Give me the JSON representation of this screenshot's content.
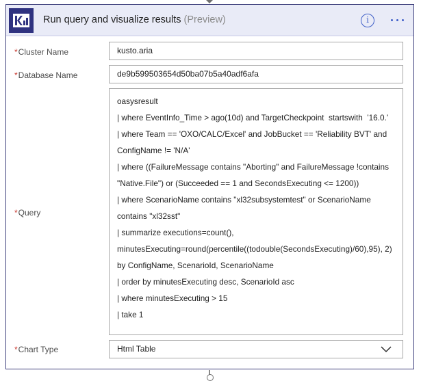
{
  "card": {
    "title": "Run query and visualize results",
    "preview_tag": "(Preview)",
    "logo_icon": "kusto-logo-icon",
    "info_icon": "info-icon",
    "more_icon": "more-options-icon",
    "accent_color": "#3b3d7a"
  },
  "fields": {
    "cluster": {
      "required_mark": "*",
      "label": "Cluster Name",
      "value": "kusto.aria"
    },
    "database": {
      "required_mark": "*",
      "label": "Database Name",
      "value": "de9b599503654d50ba07b5a40adf6afa"
    },
    "query": {
      "required_mark": "*",
      "label": "Query",
      "lines": [
        "oasysresult",
        "| where EventInfo_Time > ago(10d) and TargetCheckpoint  startswith  '16.0.'",
        "| where Team == 'OXO/CALC/Excel' and JobBucket == 'Reliability BVT' and",
        "ConfigName != 'N/A'",
        "| where ((FailureMessage contains \"Aborting\" and FailureMessage !contains",
        "\"Native.File\") or (Succeeded == 1 and SecondsExecuting <= 1200))",
        "| where ScenarioName contains \"xl32subsystemtest\" or ScenarioName",
        "contains \"xl32sst\"",
        "| summarize executions=count(),",
        "minutesExecuting=round(percentile((todouble(SecondsExecuting)/60),95), 2)",
        "by ConfigName, ScenarioId, ScenarioName",
        "| order by minutesExecuting desc, ScenarioId asc",
        "| where minutesExecuting > 15",
        "| take 1"
      ]
    },
    "chart_type": {
      "required_mark": "*",
      "label": "Chart Type",
      "value": "Html Table",
      "chevron_icon": "chevron-down-icon"
    }
  }
}
